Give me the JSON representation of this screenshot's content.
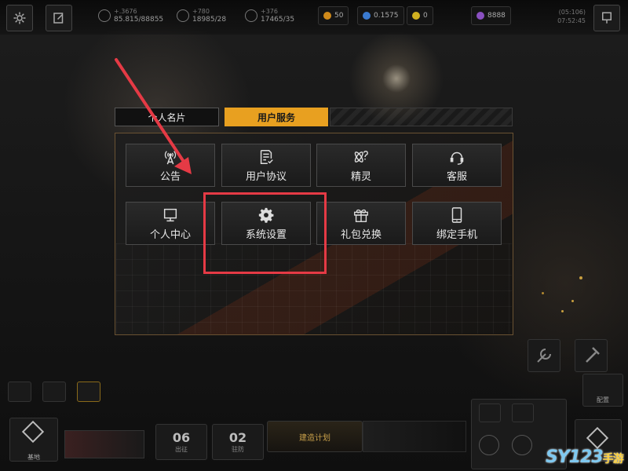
{
  "top_bar": {
    "resource_1": {
      "top": "+.3676",
      "value": "85.815/88855"
    },
    "resource_2": {
      "top": "+780",
      "value": "18985/28"
    },
    "resource_3": {
      "top": "+376",
      "value": "17465/35"
    },
    "chip_1": "50",
    "chip_2": "0.1575",
    "chip_3": "0",
    "chip_4": "8888",
    "time_top": "(05:106)",
    "time_bottom": "07:52:45"
  },
  "panel": {
    "tab_card": "个人名片",
    "tab_service": "用户服务",
    "tiles": [
      {
        "label": "公告",
        "icon": "broadcast-icon"
      },
      {
        "label": "用户协议",
        "icon": "document-check-icon"
      },
      {
        "label": "精灵",
        "icon": "sprite-icon"
      },
      {
        "label": "客服",
        "icon": "headset-icon"
      },
      {
        "label": "个人中心",
        "icon": "monitor-icon"
      },
      {
        "label": "系统设置",
        "icon": "gear-icon"
      },
      {
        "label": "礼包兑换",
        "icon": "gift-icon"
      },
      {
        "label": "绑定手机",
        "icon": "phone-icon"
      }
    ]
  },
  "bottom": {
    "stat_1": "06",
    "stat_2": "02",
    "stat_1_label": "出征",
    "stat_2_label": "驻防",
    "base_label": "基地",
    "center_label": "建造计划",
    "right_label": "配置"
  },
  "watermark": {
    "main": "SY123",
    "suffix": "手游"
  },
  "colors": {
    "accent": "#e8a020",
    "highlight": "#e53a45",
    "tile_border": "#4a4a4a"
  }
}
